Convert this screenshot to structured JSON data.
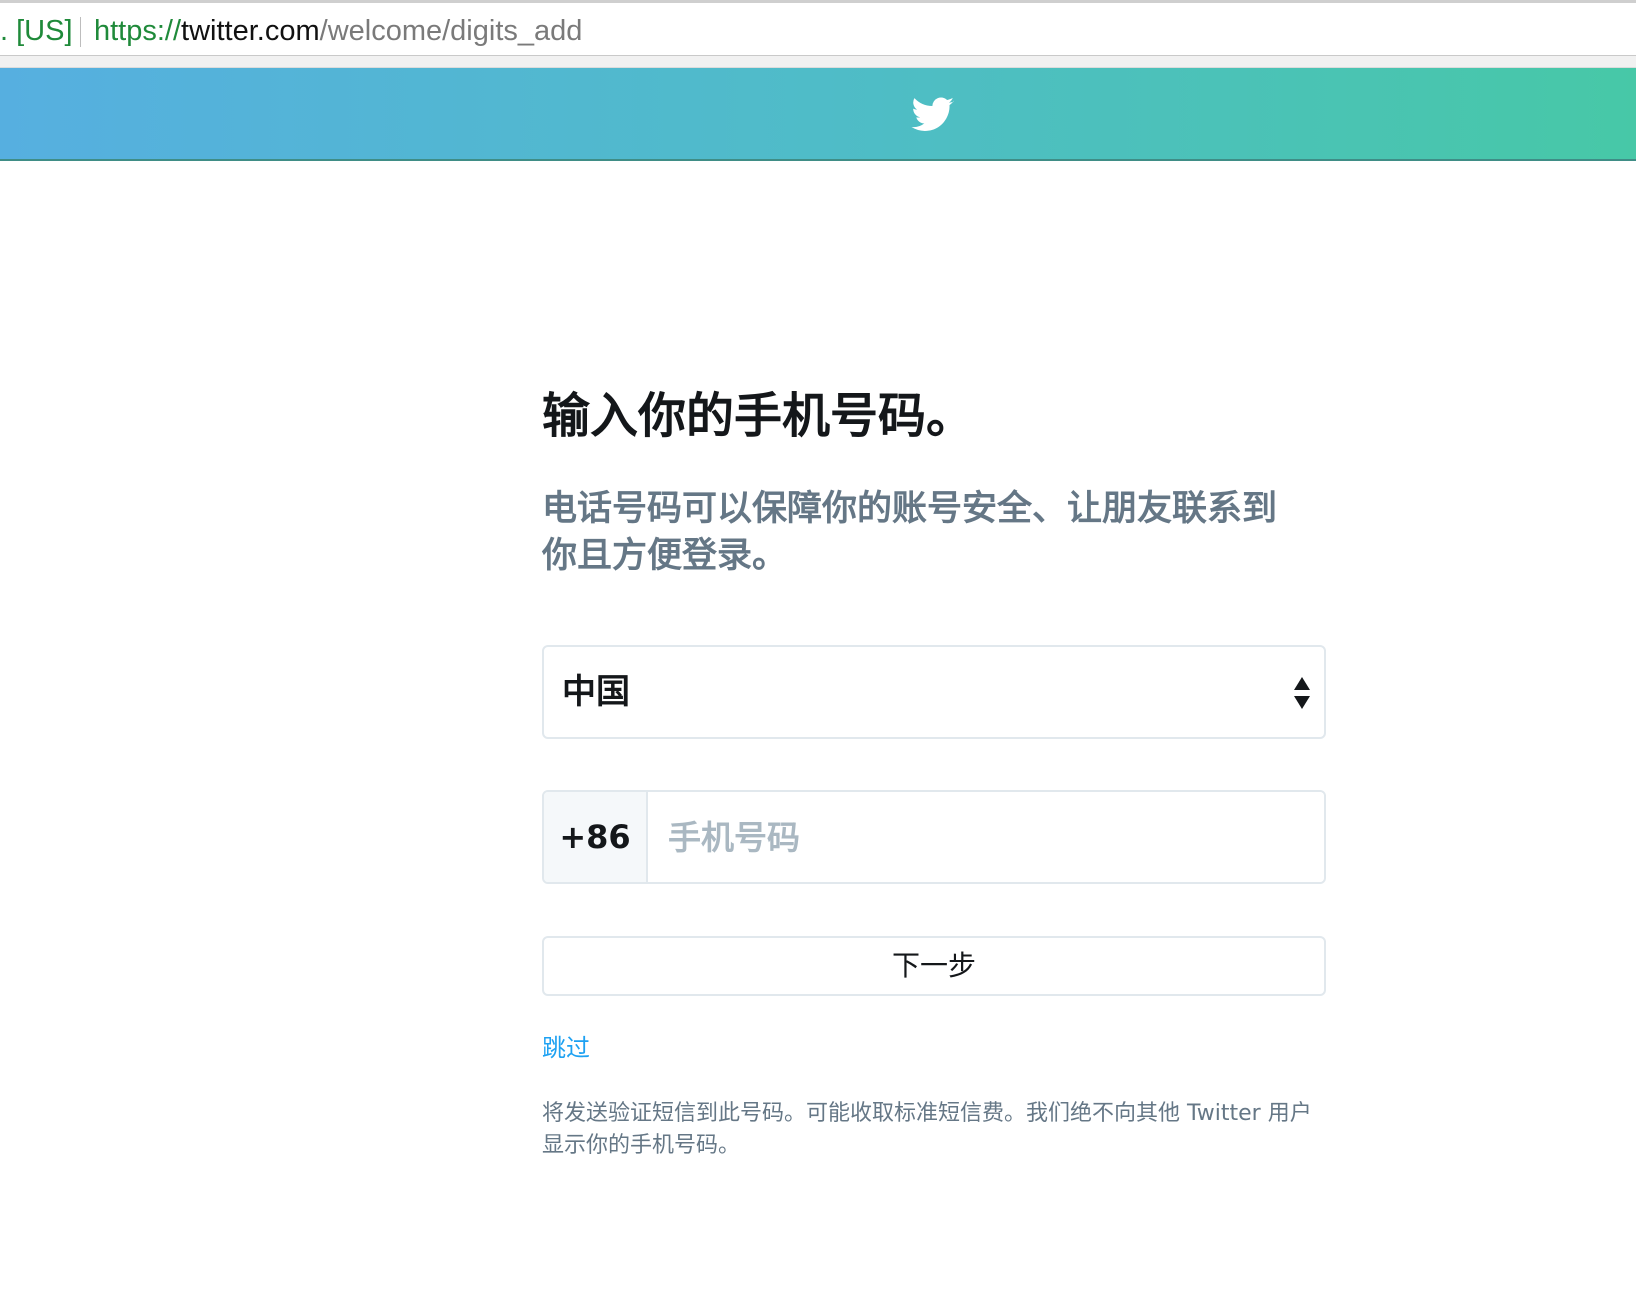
{
  "browser": {
    "security_label": ". [US]",
    "url_scheme": "https://",
    "url_host": "twitter.com",
    "url_path": "/welcome/digits_add"
  },
  "header": {
    "logo_icon": "twitter-bird-icon",
    "gradient_start": "#56afe0",
    "gradient_end": "#47c8a7"
  },
  "main": {
    "heading": "输入你的手机号码。",
    "subtitle": "电话号码可以保障你的账号安全、让朋友联系到你且方便登录。",
    "country_select": {
      "value": "中国",
      "icon": "select-updown-arrows-icon"
    },
    "phone": {
      "prefix": "+86",
      "placeholder": "手机号码",
      "value": ""
    },
    "next_button": "下一步",
    "skip_link": "跳过",
    "note": "将发送验证短信到此号码。可能收取标准短信费。我们绝不向其他 Twitter 用户显示你的手机号码。"
  },
  "colors": {
    "link": "#1da1f2",
    "secondary_text": "#657786",
    "primary_text": "#14171a",
    "border": "#e1e8ed"
  }
}
